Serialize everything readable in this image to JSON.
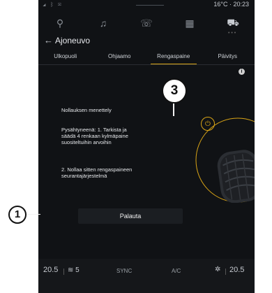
{
  "status": {
    "left_icons": "◢ ᛒ ✉",
    "temperature": "16°C",
    "time": "20:23"
  },
  "nav": {
    "items": [
      {
        "name": "location-pin-icon",
        "glyph": "⚲"
      },
      {
        "name": "music-note-icon",
        "glyph": "♫"
      },
      {
        "name": "phone-icon",
        "glyph": "☏"
      },
      {
        "name": "apps-grid-icon",
        "glyph": "▦"
      },
      {
        "name": "car-icon",
        "glyph": "⛟"
      }
    ]
  },
  "header": {
    "back_glyph": "←",
    "title": "Ajoneuvo"
  },
  "tabs": [
    {
      "label": "Ulkopuoli"
    },
    {
      "label": "Ohjaamo"
    },
    {
      "label": "Rengaspaine"
    },
    {
      "label": "Päivitys"
    }
  ],
  "content": {
    "info_glyph": "i",
    "heading": "Nollauksen menettely",
    "step1": "Pysähtyneenä: 1. Tarkista ja säädä 4 renkaan kylmäpaine suositeltuihin arvoihin",
    "step2": "2. Nollaa sitten rengaspaineen seurantajärjestelmä",
    "power_glyph": "⏻",
    "button_label": "Palauta"
  },
  "bottom": {
    "left_temp": "20.5",
    "seat_glyph": "≋",
    "seat_level": "5",
    "sync": "SYNC",
    "ac": "A/C",
    "fan_glyph": "✲",
    "right_temp": "20.5"
  },
  "callouts": {
    "one": "1",
    "three": "3"
  },
  "colors": {
    "screen_bg": "#101215",
    "accent": "#d9a416",
    "text": "#e6e8eb"
  }
}
